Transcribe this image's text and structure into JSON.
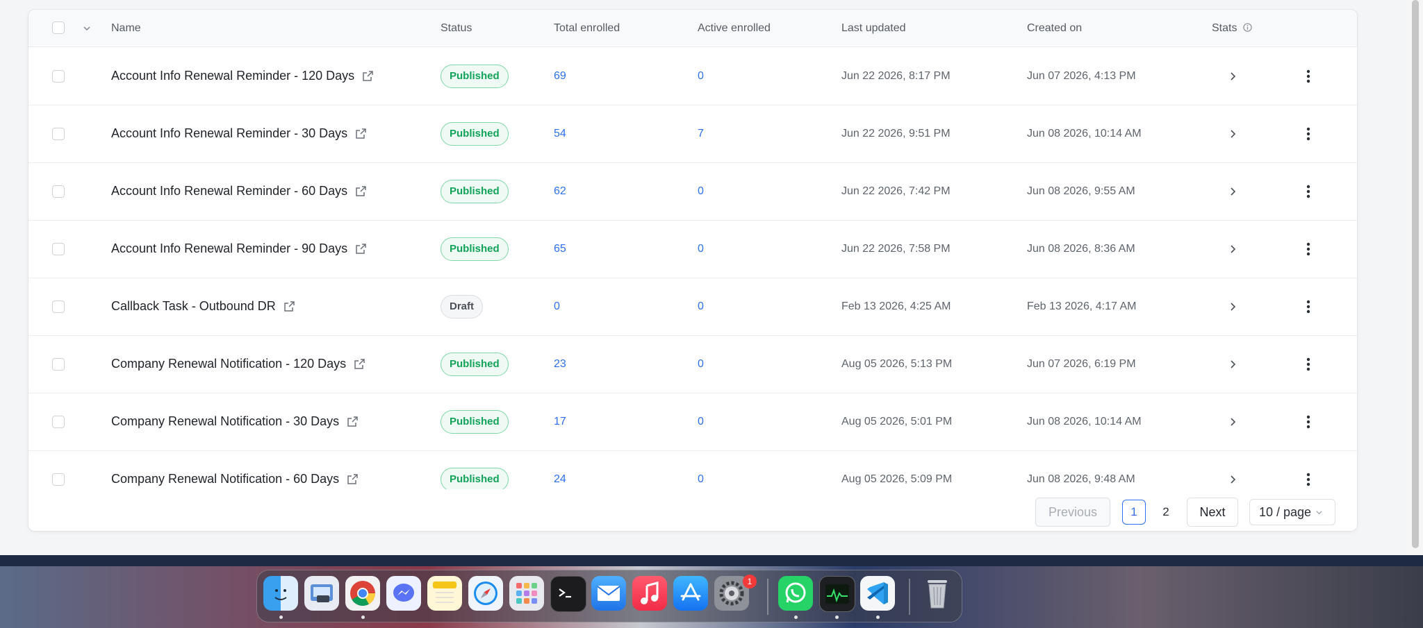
{
  "table": {
    "headers": {
      "name": "Name",
      "status": "Status",
      "total_enrolled": "Total enrolled",
      "active_enrolled": "Active enrolled",
      "last_updated": "Last updated",
      "created_on": "Created on",
      "stats": "Stats"
    },
    "rows": [
      {
        "name": "Account Info Renewal Reminder - 120 Days",
        "status": "Published",
        "status_kind": "published",
        "total": "69",
        "active": "0",
        "updated": "Jun 22 2026, 8:17 PM",
        "created": "Jun 07 2026, 4:13 PM"
      },
      {
        "name": "Account Info Renewal Reminder - 30 Days",
        "status": "Published",
        "status_kind": "published",
        "total": "54",
        "active": "7",
        "updated": "Jun 22 2026, 9:51 PM",
        "created": "Jun 08 2026, 10:14 AM"
      },
      {
        "name": "Account Info Renewal Reminder - 60 Days",
        "status": "Published",
        "status_kind": "published",
        "total": "62",
        "active": "0",
        "updated": "Jun 22 2026, 7:42 PM",
        "created": "Jun 08 2026, 9:55 AM"
      },
      {
        "name": "Account Info Renewal Reminder - 90 Days",
        "status": "Published",
        "status_kind": "published",
        "total": "65",
        "active": "0",
        "updated": "Jun 22 2026, 7:58 PM",
        "created": "Jun 08 2026, 8:36 AM"
      },
      {
        "name": "Callback Task - Outbound DR",
        "status": "Draft",
        "status_kind": "draft",
        "total": "0",
        "active": "0",
        "updated": "Feb 13 2026, 4:25 AM",
        "created": "Feb 13 2026, 4:17 AM"
      },
      {
        "name": "Company Renewal Notification - 120 Days",
        "status": "Published",
        "status_kind": "published",
        "total": "23",
        "active": "0",
        "updated": "Aug 05 2026, 5:13 PM",
        "created": "Jun 07 2026, 6:19 PM"
      },
      {
        "name": "Company Renewal Notification - 30 Days",
        "status": "Published",
        "status_kind": "published",
        "total": "17",
        "active": "0",
        "updated": "Aug 05 2026, 5:01 PM",
        "created": "Jun 08 2026, 10:14 AM"
      },
      {
        "name": "Company Renewal Notification - 60 Days",
        "status": "Published",
        "status_kind": "published",
        "total": "24",
        "active": "0",
        "updated": "Aug 05 2026, 5:09 PM",
        "created": "Jun 08 2026, 9:48 AM"
      }
    ]
  },
  "pagination": {
    "previous": "Previous",
    "pages": [
      "1",
      "2"
    ],
    "current_page": "1",
    "next": "Next",
    "page_size": "10 / page"
  },
  "dock": {
    "apps": [
      "finder-icon",
      "preview-icon",
      "chrome-icon",
      "messenger-icon",
      "notes-icon",
      "safari-icon",
      "launchpad-icon",
      "terminal-icon",
      "mail-icon",
      "music-icon",
      "app-store-icon",
      "system-settings-icon",
      "whatsapp-icon",
      "activity-monitor-icon",
      "vscode-icon",
      "trash-icon"
    ],
    "settings_badge": "1"
  },
  "colors": {
    "accent_blue": "#2d6ff0",
    "published_green": "#11a35a",
    "border": "#e3e5e8"
  }
}
